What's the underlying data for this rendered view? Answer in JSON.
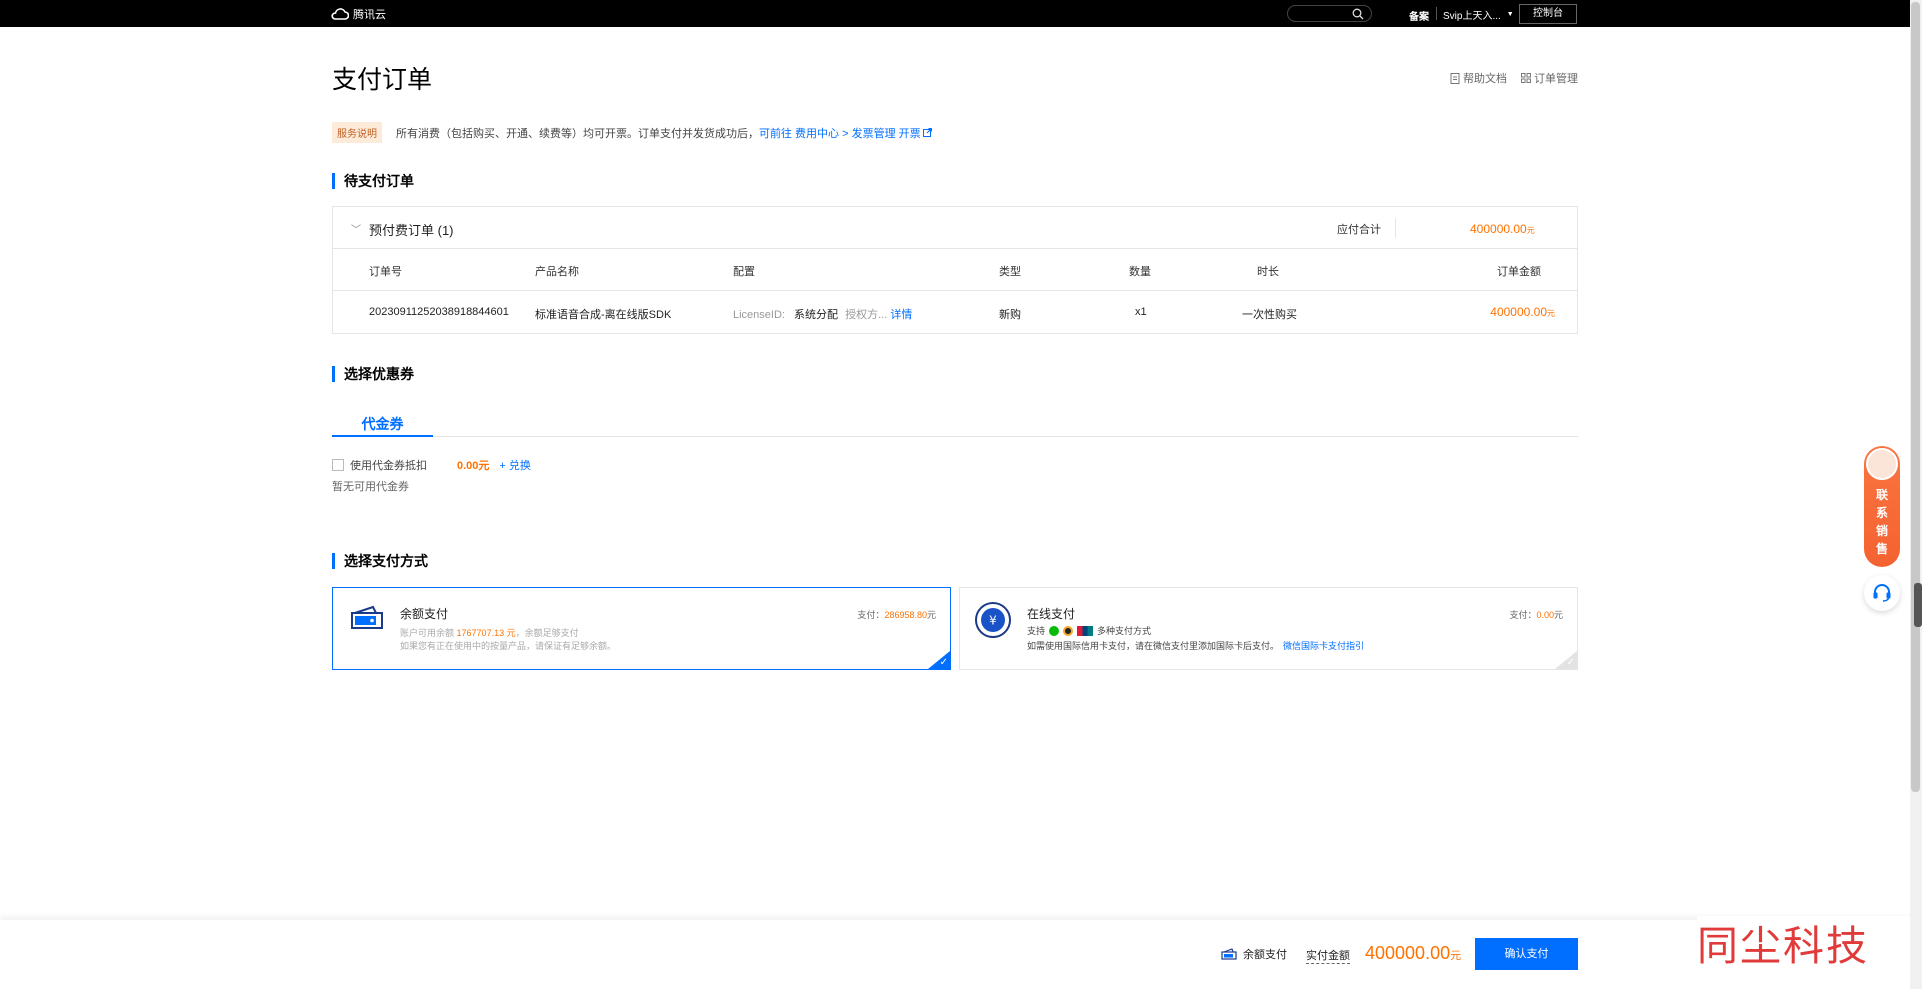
{
  "topbar": {
    "brand": "腾讯云",
    "beian": "备案",
    "user": "Svip上天入...",
    "console": "控制台"
  },
  "page": {
    "title": "支付订单",
    "help_docs": "帮助文档",
    "order_mgmt": "订单管理"
  },
  "notice": {
    "tag": "服务说明",
    "text": "所有消费（包括购买、开通、续费等）均可开票。订单支付并发货成功后，",
    "link": "可前往 费用中心 > 发票管理 开票"
  },
  "pending": {
    "title": "待支付订单",
    "group": "预付费订单 (1)",
    "due_label": "应付合计",
    "due_value": "400000.00",
    "due_unit": "元",
    "columns": {
      "order_no": "订单号",
      "product": "产品名称",
      "config": "配置",
      "type": "类型",
      "qty": "数量",
      "duration": "时长",
      "amount": "订单金额"
    },
    "row": {
      "order_no": "20230911252038918844601",
      "product": "标准语音合成-离在线版SDK",
      "config_key": "LicenseID:",
      "config_val": "系统分配",
      "config_more": "授权方...",
      "detail": "详情",
      "type": "新购",
      "qty": "x1",
      "duration": "一次性购买",
      "amount": "400000.00",
      "amount_unit": "元"
    }
  },
  "coupon": {
    "title": "选择优惠券",
    "tab": "代金券",
    "use_label": "使用代金券抵扣",
    "amount": "0.00元",
    "exchange": "+ 兑换",
    "empty": "暂无可用代金券"
  },
  "payment": {
    "title": "选择支付方式",
    "balance": {
      "name": "余额支付",
      "available_prefix": "账户可用余额",
      "available_value": "1767707.13 元",
      "available_suffix": "，余额足够支付",
      "note": "如果您有正在使用中的按量产品，请保证有足够余额。",
      "pay_label": "支付：",
      "pay_value": "286958.80",
      "pay_unit": "元"
    },
    "online": {
      "name": "在线支付",
      "support": "支持",
      "multi": "多种支付方式",
      "note": "如需使用国际信用卡支付，请在微信支付里添加国际卡后支付。",
      "guide": "微信国际卡支付指引",
      "pay_label": "支付：",
      "pay_value": "0.00",
      "pay_unit": "元"
    }
  },
  "footer": {
    "method": "余额支付",
    "actual_label": "实付金额",
    "total": "400000.00",
    "total_unit": "元",
    "confirm": "确认支付"
  },
  "sales": {
    "text": "联系销售"
  },
  "watermark": "同尘科技",
  "colors": {
    "accent": "#006eff",
    "price": "#ff7200",
    "sales": "#f46230"
  }
}
